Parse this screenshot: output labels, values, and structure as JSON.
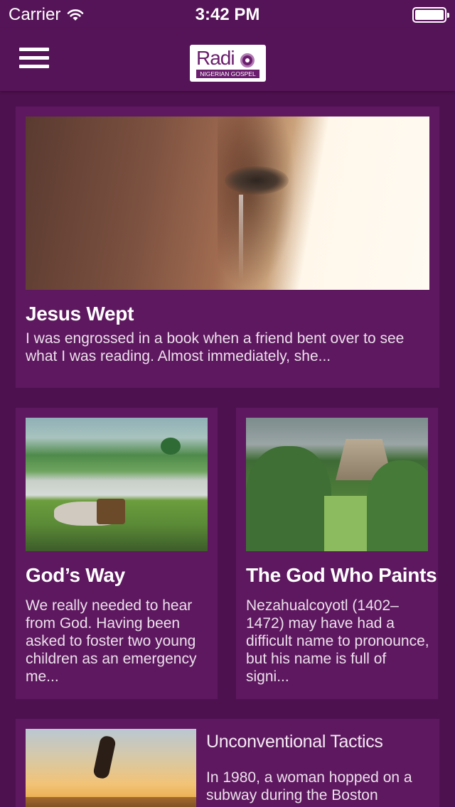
{
  "status_bar": {
    "carrier": "Carrier",
    "time": "3:42 PM",
    "icons": [
      "wifi-icon",
      "battery-icon"
    ]
  },
  "nav": {
    "menu_icon": "hamburger-icon",
    "logo_text": "Radio",
    "logo_subtext": "NIGERIAN GOSPEL"
  },
  "articles": [
    {
      "title": "Jesus Wept",
      "excerpt": "I was engrossed in a book when a friend bent over to see what I was reading. Almost immediately, she..."
    },
    {
      "title": "God’s Way",
      "excerpt": "We really needed to hear from God. Having been asked to foster two young children as an emergency me..."
    },
    {
      "title": "The God Who Paints",
      "excerpt": "Nezahualcoyotl (1402–1472) may have had a difficult name to pronounce, but his name is full of signi..."
    },
    {
      "title": "Unconventional Tactics",
      "excerpt": "In 1980, a woman hopped on a subway during the Boston"
    }
  ],
  "colors": {
    "background": "#4e1150",
    "nav": "#561458",
    "card": "#5e185f",
    "brand": "#6b1e6e"
  }
}
